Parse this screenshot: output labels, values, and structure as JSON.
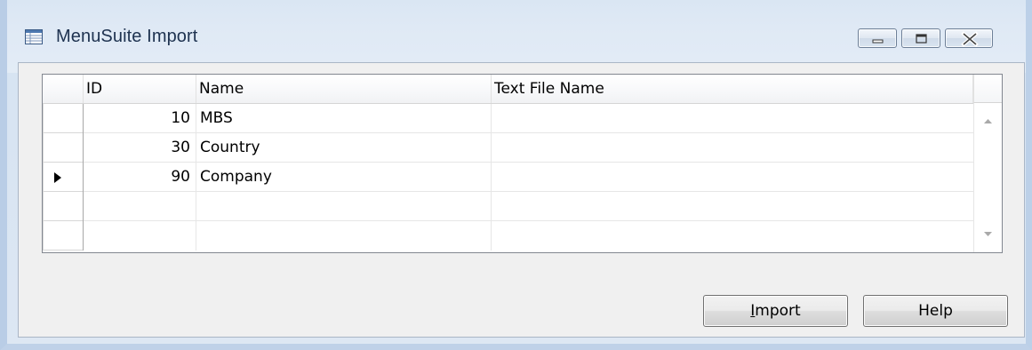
{
  "window": {
    "title": "MenuSuite Import",
    "icon": "table-form-icon"
  },
  "caption_buttons": {
    "minimize_icon": "minimize-icon",
    "maximize_icon": "maximize-icon",
    "close_icon": "close-icon"
  },
  "table": {
    "columns": [
      "",
      "ID",
      "Name",
      "Text File Name"
    ],
    "rows": [
      {
        "id": "10",
        "name": "MBS",
        "text_file_name": "",
        "current": false
      },
      {
        "id": "30",
        "name": "Country",
        "text_file_name": "",
        "current": false
      },
      {
        "id": "90",
        "name": "Company",
        "text_file_name": "",
        "current": true
      },
      {
        "id": "",
        "name": "",
        "text_file_name": "",
        "current": false
      },
      {
        "id": "",
        "name": "",
        "text_file_name": "",
        "current": false
      }
    ],
    "current_row_icon": "row-pointer-icon"
  },
  "buttons": {
    "import_accel": "I",
    "import_rest": "mport",
    "help_label": "Help"
  },
  "colors": {
    "frame": "#b9cde6",
    "title_text": "#1e3250",
    "client_bg": "#f0f0f0"
  }
}
